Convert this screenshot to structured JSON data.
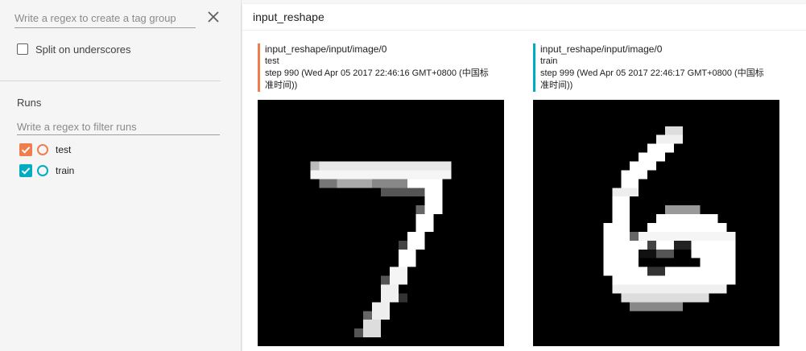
{
  "sidebar": {
    "tag_regex_placeholder": "Write a regex to create a tag group",
    "split_label": "Split on underscores",
    "runs_title": "Runs",
    "runs_filter_placeholder": "Write a regex to filter runs",
    "runs": [
      {
        "label": "test",
        "checked": true,
        "color": "#ef7e4c"
      },
      {
        "label": "train",
        "checked": true,
        "color": "#00acc1"
      }
    ]
  },
  "main": {
    "card_title": "input_reshape",
    "images": [
      {
        "tag": "input_reshape/input/image/0",
        "run": "test",
        "step_text": "step 990 (Wed Apr 05 2017 22:46:16 GMT+0800 (中国标准时间))",
        "color": "#ef7e4c",
        "depicts": "handwritten digit 7"
      },
      {
        "tag": "input_reshape/input/image/0",
        "run": "train",
        "step_text": "step 999 (Wed Apr 05 2017 22:46:17 GMT+0800 (中国标准时间))",
        "color": "#00acc1",
        "depicts": "handwritten digit 6"
      }
    ]
  }
}
